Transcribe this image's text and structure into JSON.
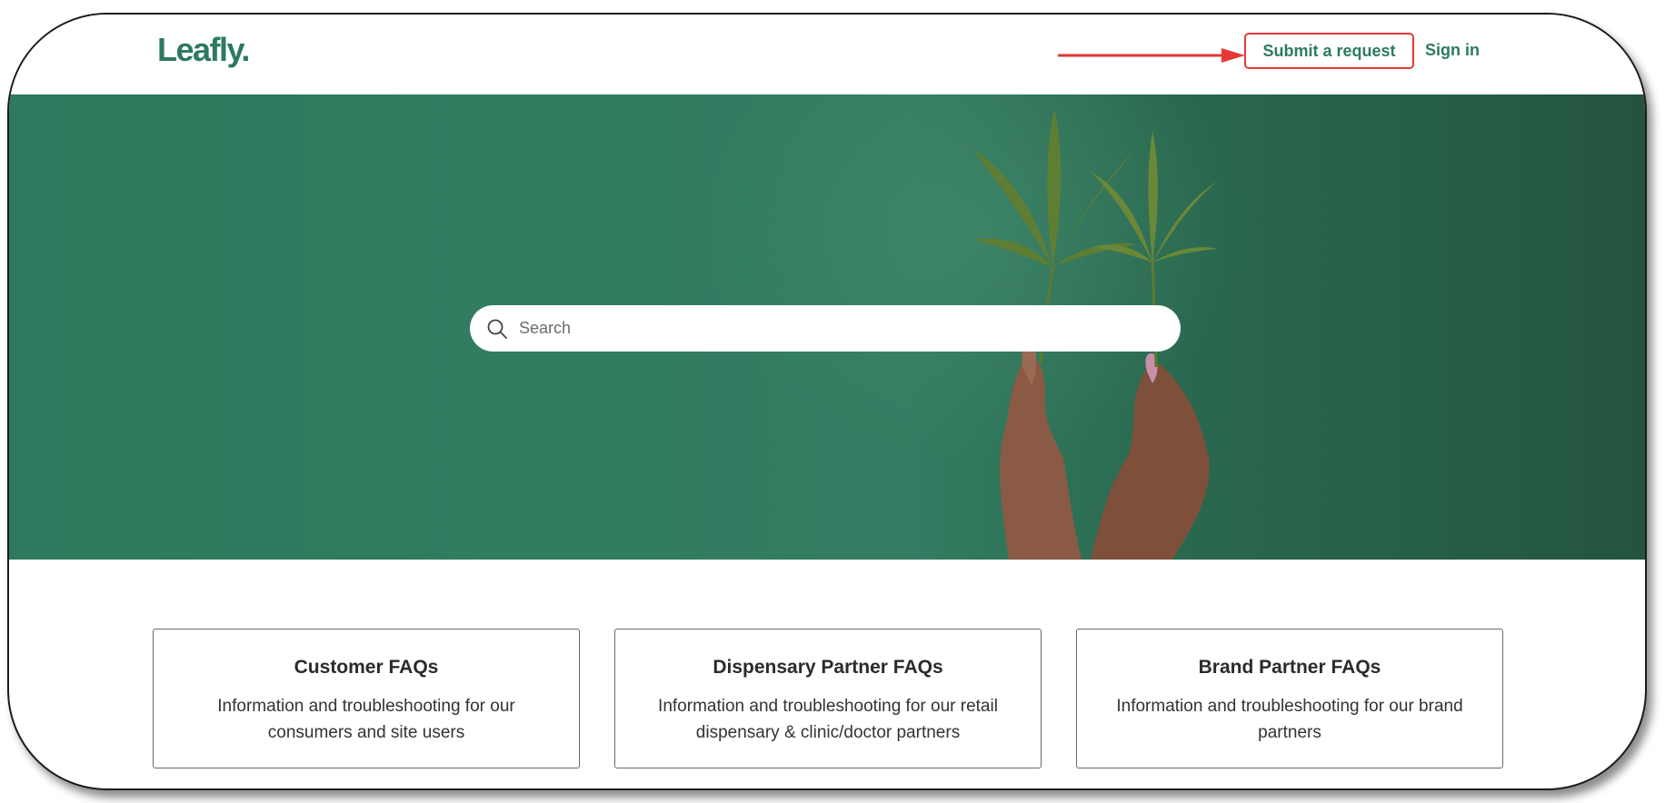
{
  "header": {
    "logo_text": "Leafly.",
    "submit_label": "Submit a request",
    "signin_label": "Sign in"
  },
  "hero": {
    "search_placeholder": "Search"
  },
  "cards": [
    {
      "title": "Customer FAQs",
      "desc": "Information and troubleshooting for our consumers and site users"
    },
    {
      "title": "Dispensary Partner FAQs",
      "desc": "Information and troubleshooting for our retail dispensary & clinic/doctor partners"
    },
    {
      "title": "Brand Partner FAQs",
      "desc": "Information and troubleshooting for our brand partners"
    }
  ],
  "colors": {
    "brand_green": "#2d7a60",
    "annotation_red": "#e53935",
    "hero_green": "#327c60"
  }
}
